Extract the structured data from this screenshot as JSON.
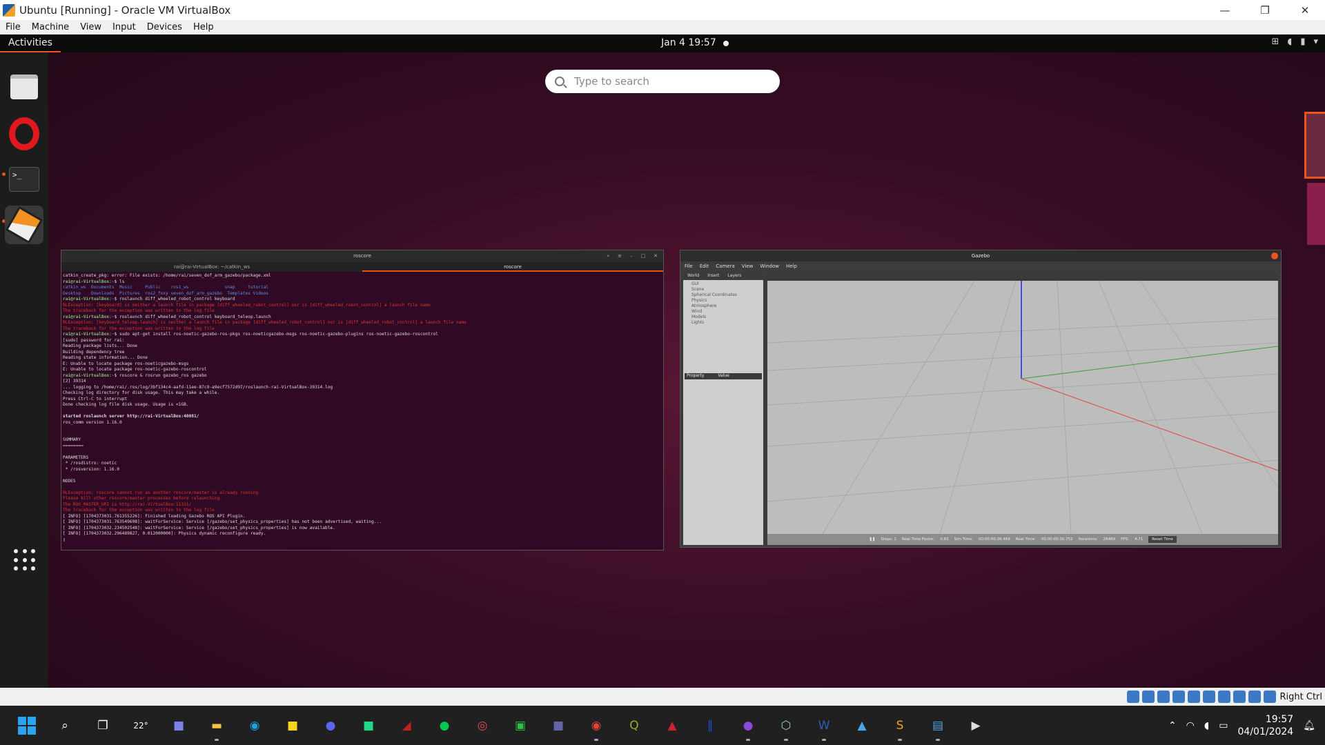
{
  "vbox": {
    "title": "Ubuntu [Running] - Oracle VM VirtualBox",
    "menu": [
      "File",
      "Machine",
      "View",
      "Input",
      "Devices",
      "Help"
    ],
    "host_key": "Right Ctrl"
  },
  "guest": {
    "activities": "Activities",
    "clock": "Jan 4  19:57",
    "search_placeholder": "Type to search",
    "terminal": {
      "title": "roscore",
      "tabs": [
        "rai@rai-VirtualBox: ~/catkin_ws",
        "roscore"
      ]
    },
    "gazebo": {
      "title": "Gazebo",
      "menu": [
        "File",
        "Edit",
        "Camera",
        "View",
        "Window",
        "Help"
      ],
      "panel_tabs": [
        "World",
        "Insert",
        "Layers"
      ],
      "tree": [
        "GUI",
        "Scene",
        "Spherical Coordinates",
        "Physics",
        "Atmosphere",
        "Wind",
        "Models",
        "Lights"
      ],
      "property": "Property",
      "value": "Value",
      "status": [
        "Steps: 1",
        "Real Time Factor:",
        "0.83",
        "Sim Time:",
        "00:00:00:26.469",
        "Real Time:",
        "00:00:00:30.752",
        "Iterations:",
        "26469",
        "FPS:",
        "4.71"
      ],
      "reset": "Reset Time"
    }
  },
  "taskbar": {
    "weather": "22°",
    "time": "19:57",
    "date": "04/01/2024"
  }
}
